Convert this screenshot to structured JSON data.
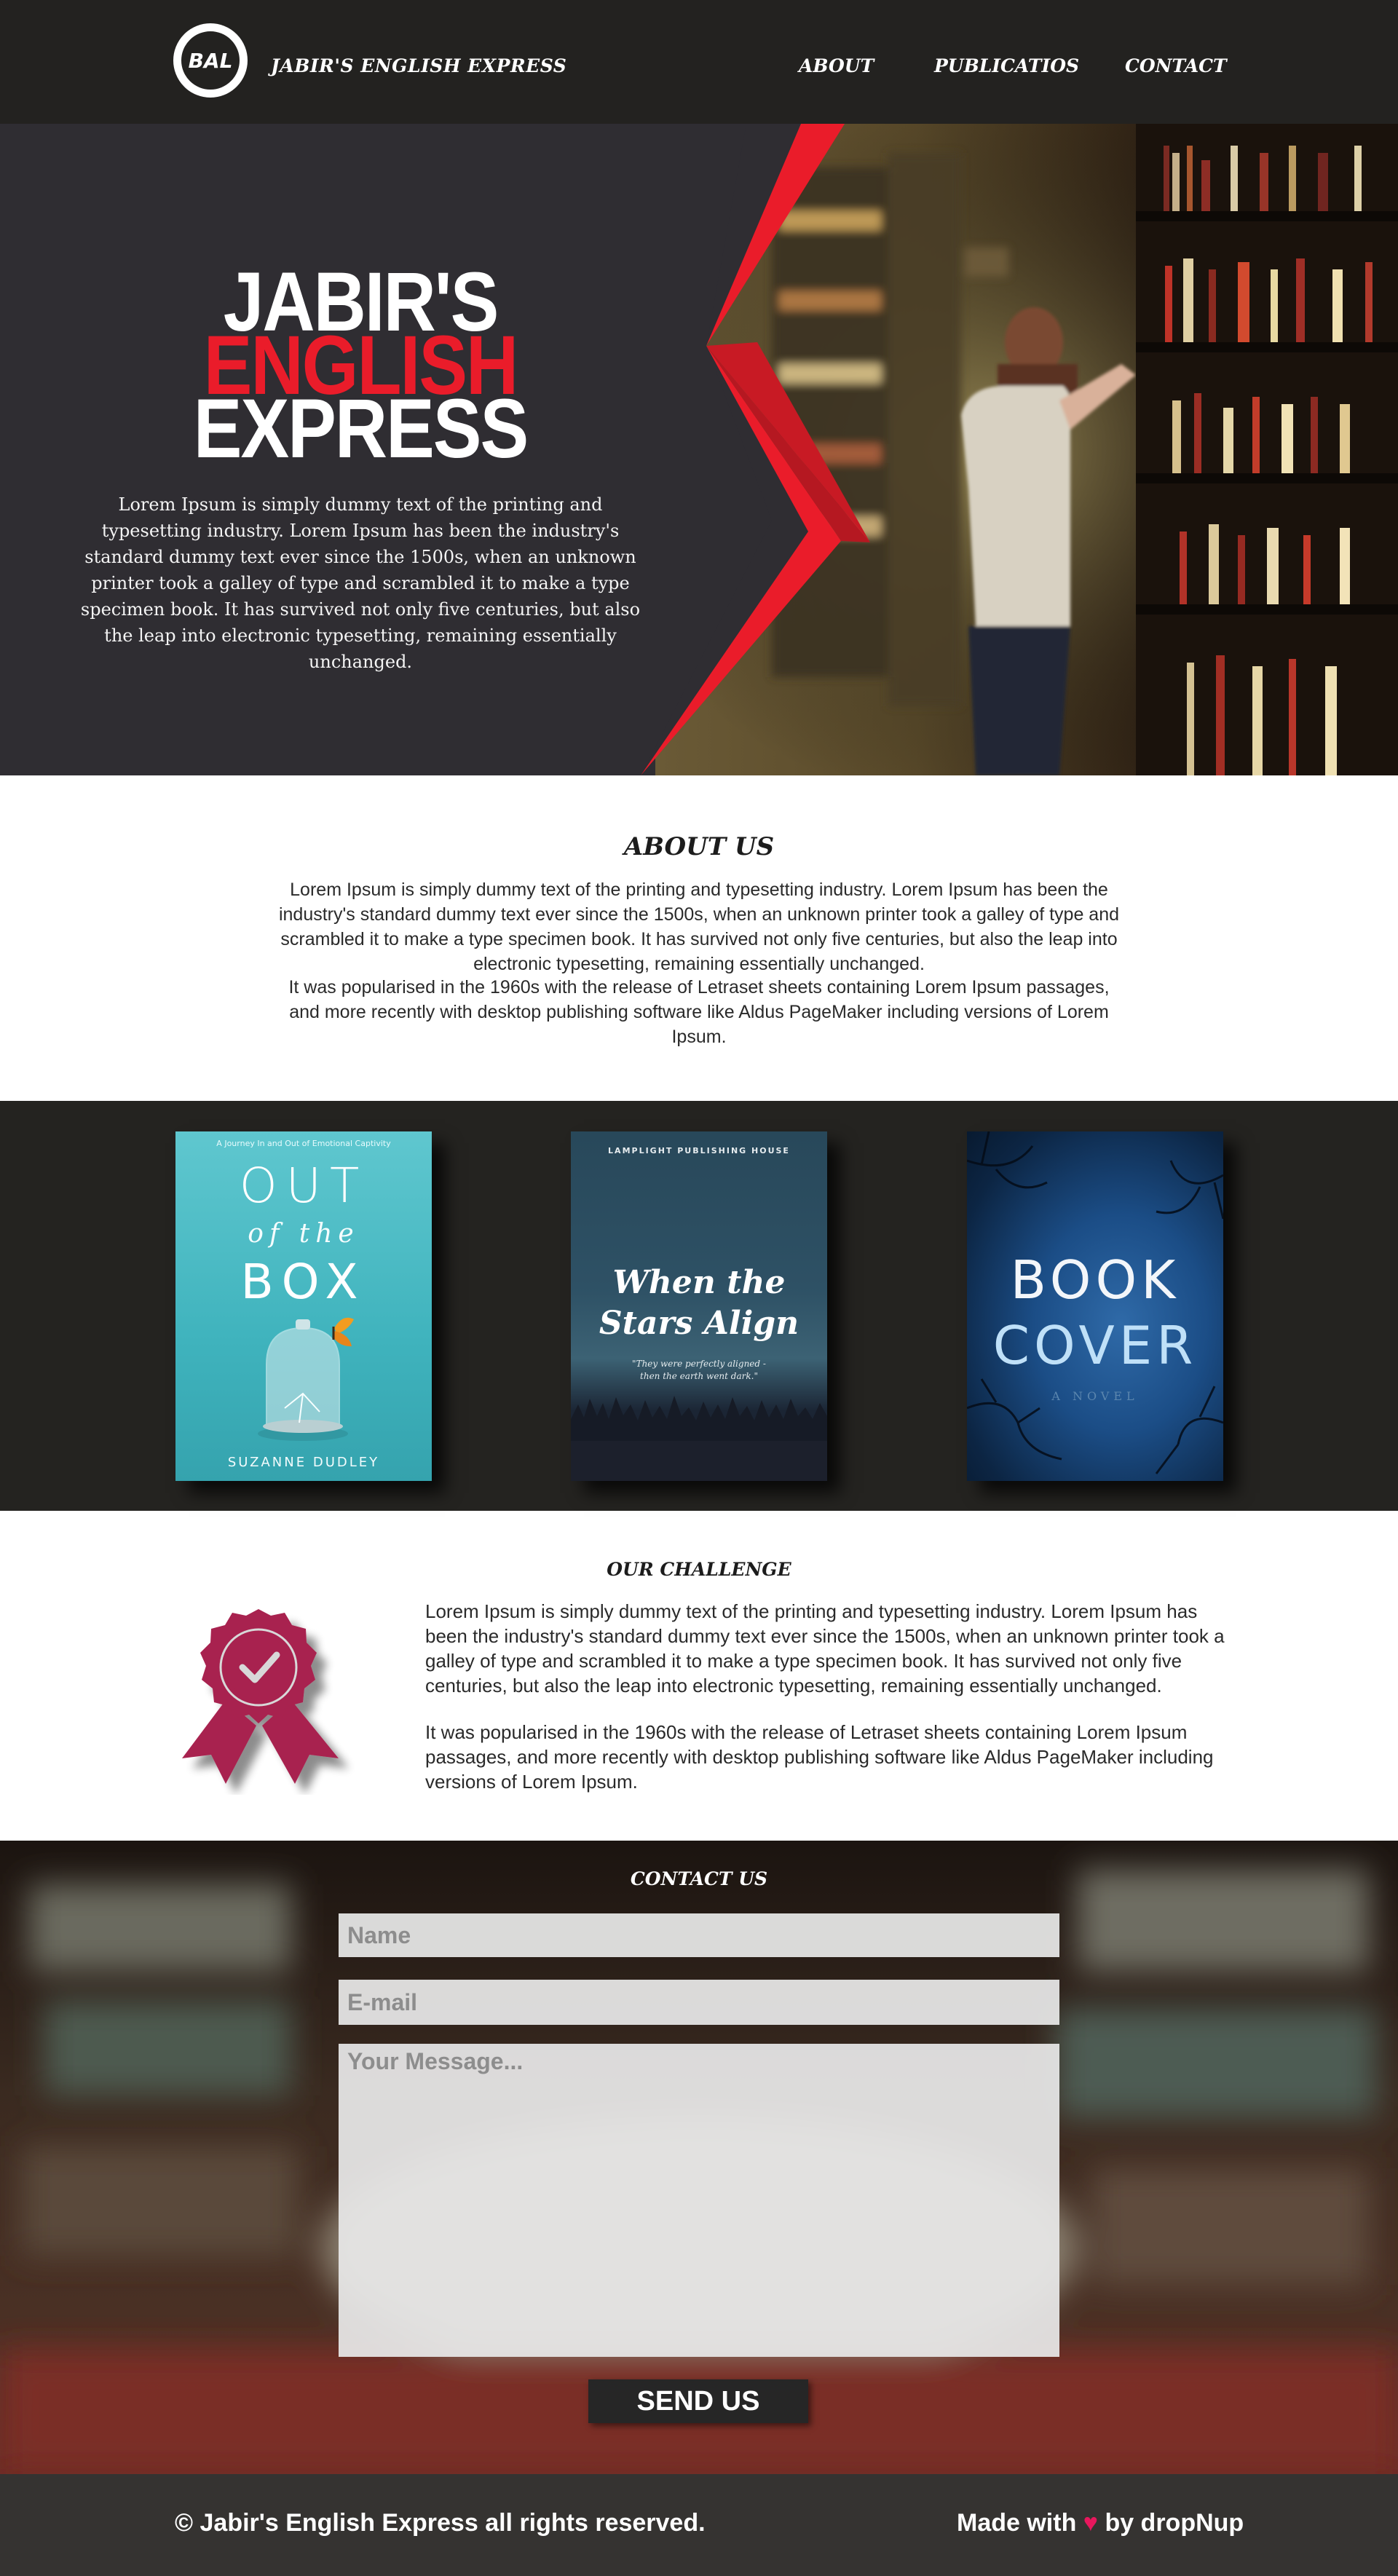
{
  "header": {
    "logo_text": "BAL",
    "brand": "JABIR'S ENGLISH EXPRESS",
    "nav": [
      {
        "label": "ABOUT"
      },
      {
        "label": "PUBLICATIOS"
      },
      {
        "label": "CONTACT"
      }
    ]
  },
  "hero": {
    "title_line1": "JABIR'S",
    "title_line2": "ENGLISH",
    "title_line3": "EXPRESS",
    "text": "Lorem Ipsum is simply dummy text of the printing and typesetting industry. Lorem Ipsum has been the industry's standard dummy text ever since the 1500s, when an unknown printer took a galley of type and scrambled it to make a type specimen book. It has survived not only five centuries, but also the leap into electronic typesetting, remaining essentially unchanged."
  },
  "about": {
    "heading": "ABOUT US",
    "paragraph1": "Lorem Ipsum is simply dummy text of the printing and typesetting industry. Lorem Ipsum has been the industry's standard dummy text ever since the 1500s, when an unknown printer took a galley of type and scrambled it to make a type specimen book. It has survived not only five centuries, but also the leap into electronic typesetting, remaining essentially unchanged.",
    "paragraph2": "It was popularised in the 1960s with the release of Letraset sheets containing Lorem Ipsum passages, and more recently with desktop publishing software like Aldus PageMaker including versions of Lorem Ipsum."
  },
  "books": [
    {
      "tagline": "A Journey In and Out of Emotional Captivity",
      "title_top": "OUT",
      "title_mid": "of the",
      "title_bottom": "BOX",
      "author": "SUZANNE DUDLEY"
    },
    {
      "publisher": "LAMPLIGHT PUBLISHING HOUSE",
      "title_top": "When the",
      "title_bottom": "Stars Align",
      "quote_line1": "\"They were perfectly aligned -",
      "quote_line2": "then the earth went dark.\""
    },
    {
      "title_top": "BOOK",
      "title_bottom": "COVER",
      "subtitle": "A NOVEL"
    }
  ],
  "challenge": {
    "heading": "OUR CHALLENGE",
    "paragraph1": "Lorem Ipsum is simply dummy text of the printing and typesetting industry. Lorem Ipsum has been the industry's standard dummy text ever since the 1500s, when an unknown printer took a galley of type and scrambled it to make a type specimen book. It has survived not only five centuries, but also the leap into electronic typesetting, remaining essentially unchanged.",
    "paragraph2": "It was popularised in the 1960s with the release of Letraset sheets containing Lorem Ipsum passages, and more recently with desktop publishing software like Aldus PageMaker including versions of Lorem Ipsum.",
    "icon": "award-ribbon-icon"
  },
  "contact": {
    "heading": "CONTACT US",
    "name_placeholder": "Name",
    "email_placeholder": "E-mail",
    "message_placeholder": "Your Message...",
    "submit_label": "SEND US"
  },
  "footer": {
    "copyright": "© Jabir's English Express all rights reserved.",
    "made_with": "Made with",
    "heart": "♥",
    "by": "by dropNup"
  },
  "colors": {
    "dark": "#232220",
    "accent_red": "#ea1c2a",
    "ribbon": "#a8224f",
    "footer": "#353331"
  }
}
